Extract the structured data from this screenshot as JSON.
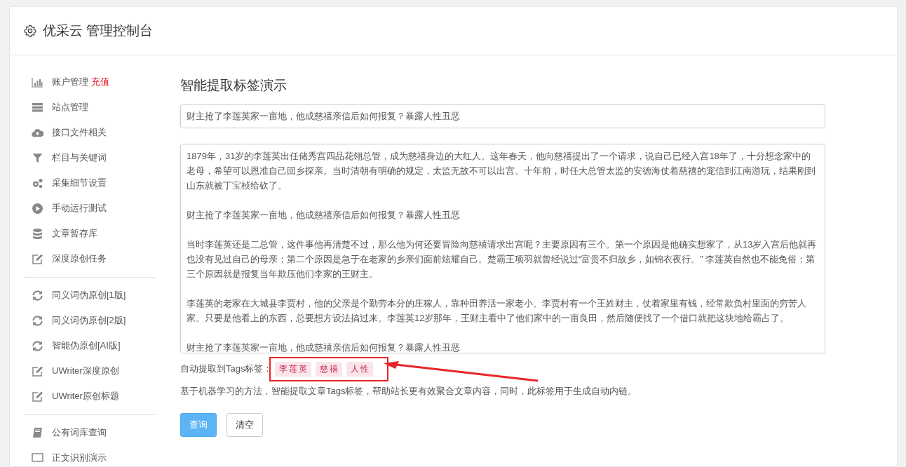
{
  "header": {
    "title": "优采云 管理控制台"
  },
  "sidebar": {
    "groups": [
      {
        "items": [
          {
            "kind": "chart",
            "label": "账户管理",
            "badge": "充值"
          },
          {
            "kind": "server",
            "label": "站点管理"
          },
          {
            "kind": "cloud",
            "label": "接口文件相关"
          },
          {
            "kind": "filter",
            "label": "栏目与关键词"
          },
          {
            "kind": "cogs",
            "label": "采集细节设置"
          },
          {
            "kind": "play",
            "label": "手动运行测试"
          },
          {
            "kind": "database",
            "label": "文章暂存库"
          },
          {
            "kind": "edit",
            "label": "深度原创任务"
          }
        ]
      },
      {
        "items": [
          {
            "kind": "refresh",
            "label": "同义词伪原创[1版]"
          },
          {
            "kind": "refresh",
            "label": "同义词伪原创[2版]"
          },
          {
            "kind": "refresh",
            "label": "智能伪原创[AI版]"
          },
          {
            "kind": "edit",
            "label": "UWriter深度原创"
          },
          {
            "kind": "edit",
            "label": "UWriter原创标题"
          }
        ]
      },
      {
        "items": [
          {
            "kind": "book",
            "label": "公有词库查询"
          },
          {
            "kind": "monitor",
            "label": "正文识别演示"
          }
        ]
      }
    ]
  },
  "main": {
    "title": "智能提取标签演示",
    "title_field": {
      "value": "财主抢了李莲英家一亩地，他成慈禧亲信后如何报复？暴露人性丑恶"
    },
    "content_field": {
      "paragraphs": [
        "1879年，31岁的李莲英出任储秀宫四品花翎总管，成为慈禧身边的大红人。这年春天，他向慈禧提出了一个请求，说自己已经入宫18年了，十分想念家中的老母，希望可以恩准自己回乡探亲。当时清朝有明确的规定，太监无故不可以出宫。十年前，时任大总管太监的安德海仗着慈禧的宠信到江南游玩，结果刚到山东就被丁宝桢给砍了。",
        "财主抢了李莲英家一亩地，他成慈禧亲信后如何报复？暴露人性丑恶",
        "当时李莲英还是二总管，这件事他再清楚不过，那么他为何还要冒险向慈禧请求出宫呢？主要原因有三个。第一个原因是他确实想家了，从13岁入宫后他就再也没有见过自己的母亲；第二个原因是急于在老家的乡亲们面前炫耀自己。楚霸王项羽就曾经说过“富贵不归故乡，如锦衣夜行。” 李莲英自然也不能免俗；第三个原因就是报复当年欺压他们李家的王财主。",
        "李莲英的老家在大城县李贾村，他的父亲是个勤劳本分的庄稼人，靠种田养活一家老小。李贾村有一个王姓财主，仗着家里有钱，经常欺负村里面的穷苦人家。只要是他看上的东西，总要想方设法搞过来。李莲英12岁那年，王财主看中了他们家中的一亩良田，然后随便找了一个借口就把这块地给霸占了。",
        "财主抢了李莲英家一亩地，他成慈禧亲信后如何报复？暴露人性丑恶"
      ]
    },
    "tags_label": "自动提取到Tags标签：",
    "tags": [
      "李莲英",
      "慈禧",
      "人性"
    ],
    "description": "基于机器学习的方法，智能提取文章Tags标签，帮助站长更有效聚合文章内容，同时，此标签用于生成自动内链。",
    "buttons": [
      {
        "label": "查询",
        "kind": "primary"
      },
      {
        "label": "清空",
        "kind": "default"
      }
    ]
  },
  "annotation": {
    "kind": "boxed-arrow"
  }
}
